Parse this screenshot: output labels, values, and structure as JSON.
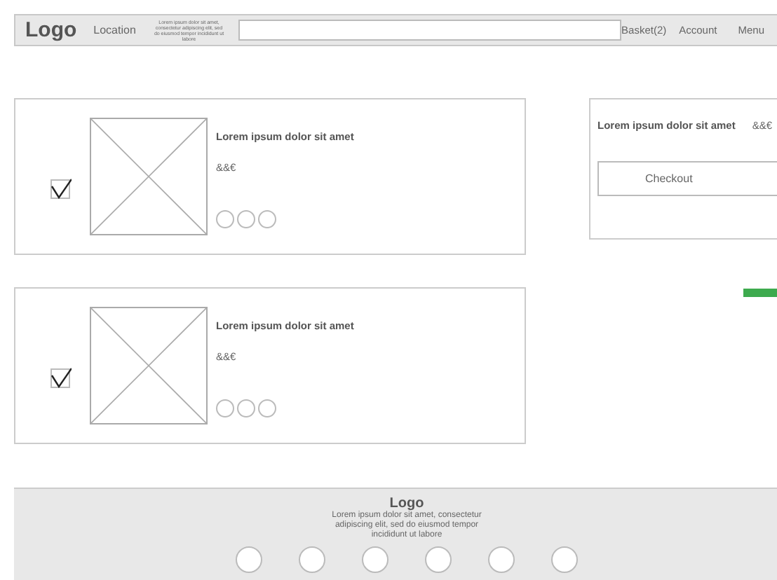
{
  "header": {
    "logo": "Logo",
    "location": "Location",
    "tagline": "Lorem ipsum dolor sit amet, consectetur adipiscing elit, sed do eiusmod tempor incididunt ut labore",
    "nav": [
      "Basket(2)",
      "Account",
      "Menu"
    ]
  },
  "cart_items": [
    {
      "checked": true,
      "title": "Lorem ipsum dolor sit amet",
      "price": "&&€"
    },
    {
      "checked": true,
      "title": "Lorem ipsum dolor sit amet",
      "price": "&&€"
    }
  ],
  "summary": {
    "title": "Lorem ipsum dolor sit amet",
    "price": "&&€",
    "button": "Checkout"
  },
  "footer": {
    "logo": "Logo",
    "text": "Lorem ipsum dolor sit amet, consectetur adipiscing elit, sed do eiusmod tempor incididunt ut labore"
  }
}
